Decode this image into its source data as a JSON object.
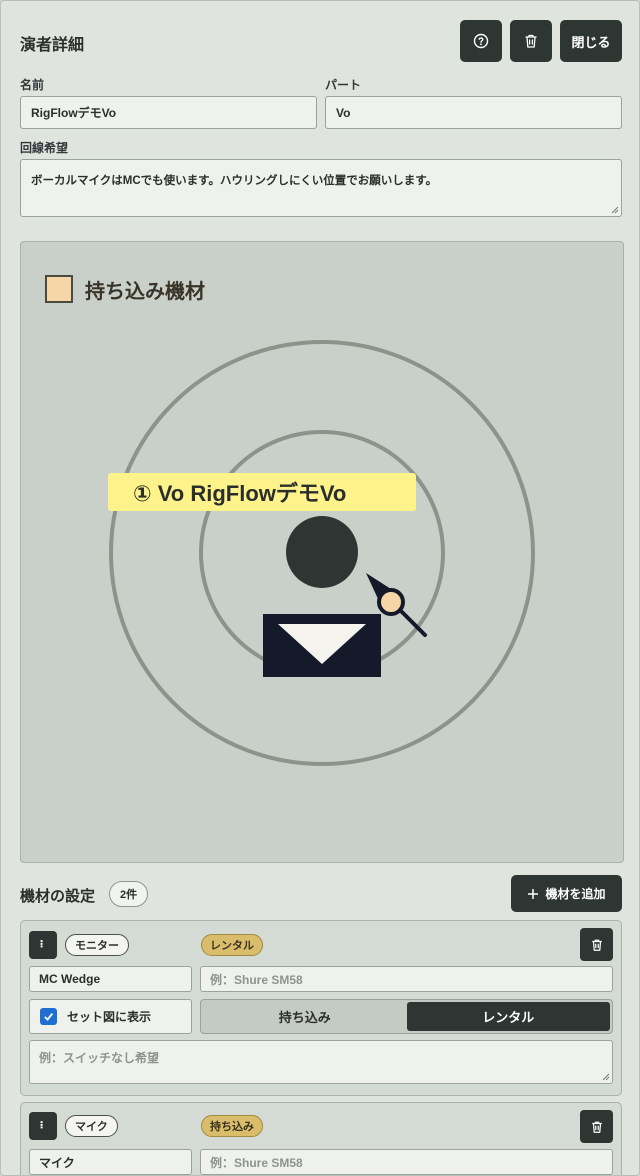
{
  "header": {
    "title": "演者詳細",
    "close_label": "閉じる",
    "help_icon": "question-circle-icon",
    "delete_icon": "trash-icon"
  },
  "form": {
    "name_label": "名前",
    "name_value": "RigFlowデモVo",
    "part_label": "パート",
    "part_value": "Vo",
    "request_label": "回線希望",
    "request_value": "ボーカルマイクはMCでも使います。ハウリングしにくい位置でお願いします。"
  },
  "stage": {
    "legend_label": "持ち込み機材",
    "performer_label": "① Vo RigFlowデモVo"
  },
  "equipment": {
    "section_title": "機材の設定",
    "count_label": "2件",
    "add_label": "機材を追加",
    "items": [
      {
        "handle": "⠇",
        "category": "モニター",
        "status": "レンタル",
        "name_value": "MC Wedge",
        "model_placeholder": "例：Shure SM58",
        "show_in_set_label": "セット図に表示",
        "source_options": [
          "持ち込み",
          "レンタル"
        ],
        "selected_source": "レンタル",
        "note_placeholder": "例：スイッチなし希望"
      },
      {
        "handle": "⠇",
        "category": "マイク",
        "status": "持ち込み",
        "name_value": "マイク",
        "model_placeholder": "例：Shure SM58"
      }
    ]
  },
  "colors": {
    "dark": "#2e3633",
    "accent_blue": "#1f6fd1",
    "status_gold": "#d9bd6a",
    "legend_swatch": "#f6d6a7",
    "label_yellow": "#fdf38a",
    "monitor_navy": "#151a2b"
  }
}
